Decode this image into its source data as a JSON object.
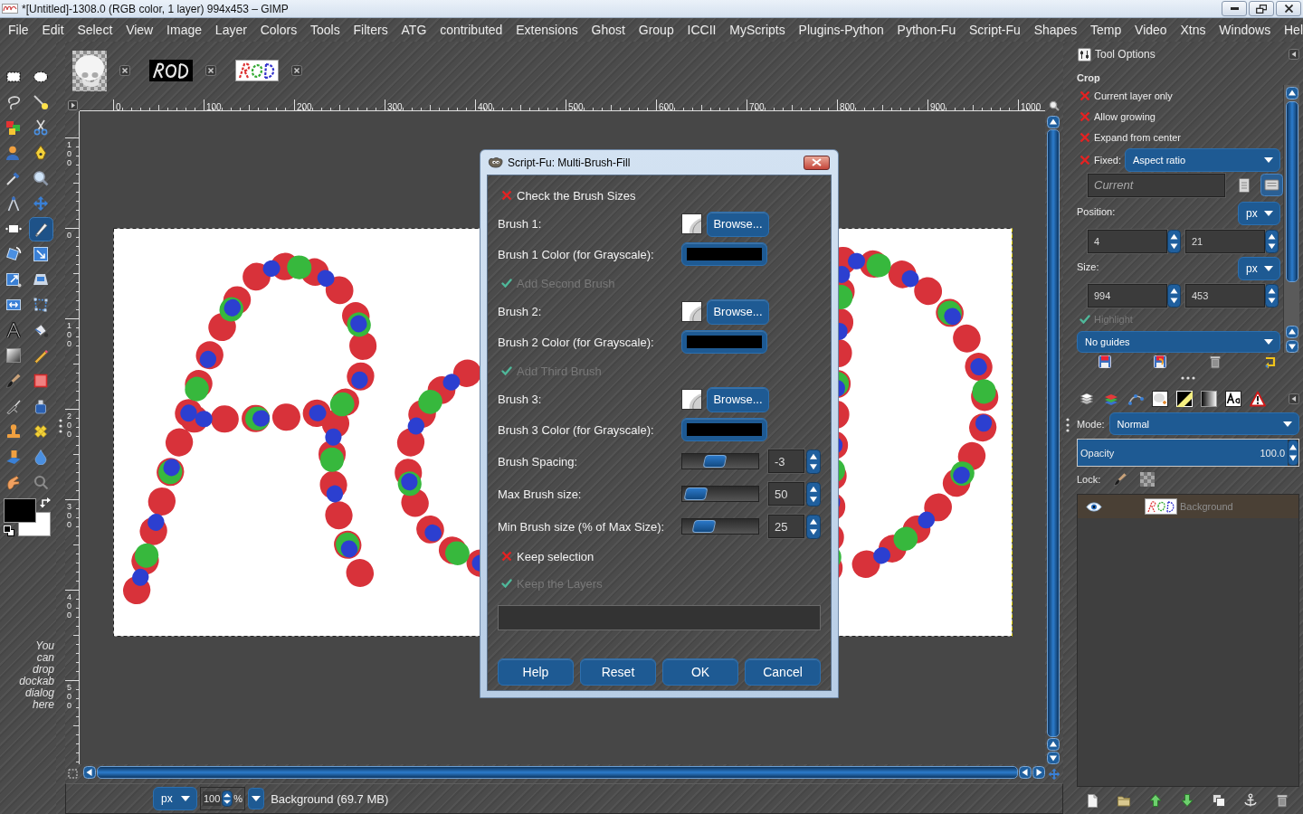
{
  "window": {
    "title": "*[Untitled]-1308.0 (RGB color, 1 layer) 994x453 – GIMP",
    "controls": [
      {
        "kind": "minimize"
      },
      {
        "kind": "maximize"
      },
      {
        "kind": "close"
      }
    ]
  },
  "menu": [
    {
      "label": "File"
    },
    {
      "label": "Edit"
    },
    {
      "label": "Select"
    },
    {
      "label": "View"
    },
    {
      "label": "Image"
    },
    {
      "label": "Layer"
    },
    {
      "label": "Colors"
    },
    {
      "label": "Tools"
    },
    {
      "label": "Filters"
    },
    {
      "label": "ATG"
    },
    {
      "label": "contributed"
    },
    {
      "label": "Extensions"
    },
    {
      "label": "Ghost"
    },
    {
      "label": "Group"
    },
    {
      "label": "ICCII"
    },
    {
      "label": "MyScripts"
    },
    {
      "label": "Plugins-Python"
    },
    {
      "label": "Python-Fu"
    },
    {
      "label": "Script-Fu"
    },
    {
      "label": "Shapes"
    },
    {
      "label": "Temp"
    },
    {
      "label": "Video"
    },
    {
      "label": "Xtns"
    },
    {
      "label": "Windows"
    },
    {
      "label": "Hel"
    }
  ],
  "toolbox": {
    "tools": [
      {
        "kind": "rect-select",
        "selected": false
      },
      {
        "kind": "ellipse-select",
        "selected": false
      },
      {
        "kind": "free-select",
        "selected": false
      },
      {
        "kind": "fuzzy-select",
        "selected": false
      },
      {
        "kind": "select-by-color",
        "selected": false
      },
      {
        "kind": "scissors",
        "selected": false
      },
      {
        "kind": "foreground-select",
        "selected": false
      },
      {
        "kind": "paths",
        "selected": false
      },
      {
        "kind": "color-picker",
        "selected": false
      },
      {
        "kind": "zoom",
        "selected": false
      },
      {
        "kind": "measure",
        "selected": false
      },
      {
        "kind": "move",
        "selected": false
      },
      {
        "kind": "align",
        "selected": false
      },
      {
        "kind": "crop",
        "selected": true
      },
      {
        "kind": "rotate",
        "selected": false
      },
      {
        "kind": "scale",
        "selected": false
      },
      {
        "kind": "shear",
        "selected": false
      },
      {
        "kind": "perspective",
        "selected": false
      },
      {
        "kind": "flip",
        "selected": false
      },
      {
        "kind": "cage",
        "selected": false
      },
      {
        "kind": "text",
        "selected": false
      },
      {
        "kind": "bucket-fill",
        "selected": false
      },
      {
        "kind": "blend",
        "selected": false
      },
      {
        "kind": "pencil",
        "selected": false
      },
      {
        "kind": "paintbrush",
        "selected": false
      },
      {
        "kind": "eraser",
        "selected": false
      },
      {
        "kind": "airbrush",
        "selected": false
      },
      {
        "kind": "ink",
        "selected": false
      },
      {
        "kind": "clone",
        "selected": false
      },
      {
        "kind": "heal",
        "selected": false
      },
      {
        "kind": "perspective-clone",
        "selected": false
      },
      {
        "kind": "blur",
        "selected": false
      },
      {
        "kind": "smudge",
        "selected": false
      },
      {
        "kind": "dodge-burn",
        "selected": false
      }
    ],
    "colors": [
      {
        "kind": "foreground",
        "color": "#000000"
      },
      {
        "kind": "background",
        "color": "#ffffff"
      }
    ],
    "hint": "You can drop dockab dialog here"
  },
  "image_tabs": [
    {
      "kind": "skull"
    },
    {
      "kind": "lettering-dark"
    },
    {
      "kind": "lettering-light"
    }
  ],
  "rulers": {
    "horizontal": [
      "0",
      "100",
      "200",
      "300",
      "400",
      "500",
      "600",
      "700",
      "800",
      "900",
      "1000"
    ],
    "vertical": [
      "100",
      "0",
      "100",
      "200",
      "300",
      "400",
      "500"
    ]
  },
  "status_bar": {
    "unit": "px",
    "zoom": "100",
    "zoom_unit": "%",
    "message": "Background (69.7 MB)"
  },
  "dialog": {
    "title": "Script-Fu: Multi-Brush-Fill",
    "rows": [
      {
        "kind": "check",
        "label": "Check the Brush Sizes",
        "checked": false,
        "disabled": false
      },
      {
        "kind": "brush",
        "label": "Brush 1:",
        "button": "Browse..."
      },
      {
        "kind": "color",
        "label": "Brush 1 Color (for Grayscale):",
        "color": "#000000"
      },
      {
        "kind": "check",
        "label": "Add Second Brush",
        "checked": true,
        "disabled": true
      },
      {
        "kind": "brush",
        "label": "Brush 2:",
        "button": "Browse..."
      },
      {
        "kind": "color",
        "label": "Brush 2 Color (for Grayscale):",
        "color": "#000000"
      },
      {
        "kind": "check",
        "label": "Add Third Brush",
        "checked": true,
        "disabled": true
      },
      {
        "kind": "brush",
        "label": "Brush 3:",
        "button": "Browse..."
      },
      {
        "kind": "color",
        "label": "Brush 3 Color (for Grayscale):",
        "color": "#000000"
      },
      {
        "kind": "slider",
        "label": "Brush Spacing:",
        "value": "-3",
        "level": 0.4
      },
      {
        "kind": "slider",
        "label": "Max Brush size:",
        "value": "50",
        "level": 0.05
      },
      {
        "kind": "slider",
        "label": "Min Brush size (% of Max Size):",
        "value": "25",
        "level": 0.2
      },
      {
        "kind": "check",
        "label": "Keep selection",
        "checked": false,
        "disabled": false
      },
      {
        "kind": "check",
        "label": "Keep the Layers",
        "checked": true,
        "disabled": true
      },
      {
        "kind": "progress",
        "level": 0
      }
    ],
    "buttons": [
      {
        "label": "Help"
      },
      {
        "label": "Reset"
      },
      {
        "label": "OK"
      },
      {
        "label": "Cancel"
      }
    ]
  },
  "tool_options": {
    "title": "Tool Options",
    "tool": "Crop",
    "options": [
      {
        "kind": "check",
        "label": "Current layer only",
        "checked": false,
        "disabled": false
      },
      {
        "kind": "check",
        "label": "Allow growing",
        "checked": false,
        "disabled": false
      },
      {
        "kind": "check",
        "label": "Expand from center",
        "checked": false,
        "disabled": false
      },
      {
        "kind": "fixed",
        "label": "Fixed:",
        "checked": false,
        "value": "Aspect ratio"
      },
      {
        "kind": "ratio",
        "placeholder": "Current",
        "orientations": [
          {
            "kind": "portrait",
            "selected": false
          },
          {
            "kind": "landscape",
            "selected": true
          }
        ]
      },
      {
        "kind": "unit",
        "label": "Position:",
        "unit": "px"
      },
      {
        "kind": "pair",
        "values": [
          "4",
          "21"
        ]
      },
      {
        "kind": "unit",
        "label": "Size:",
        "unit": "px"
      },
      {
        "kind": "pair",
        "values": [
          "994",
          "453"
        ]
      },
      {
        "kind": "check",
        "label": "Highlight",
        "checked": true,
        "disabled": true
      },
      {
        "kind": "dropdown",
        "value": "No guides"
      }
    ],
    "buttons": [
      {
        "kind": "save"
      },
      {
        "kind": "restore"
      },
      {
        "kind": "delete"
      },
      {
        "kind": "reset"
      }
    ]
  },
  "layers_panel": {
    "tabs": [
      {
        "kind": "layers"
      },
      {
        "kind": "channels"
      },
      {
        "kind": "paths"
      },
      {
        "kind": "brushes"
      },
      {
        "kind": "patterns"
      },
      {
        "kind": "gradients"
      },
      {
        "kind": "fonts"
      },
      {
        "kind": "errors"
      }
    ],
    "mode": {
      "label": "Mode:",
      "value": "Normal"
    },
    "opacity": {
      "label": "Opacity",
      "value": "100.0",
      "level": 1
    },
    "lock": {
      "label": "Lock:",
      "items": [
        {
          "kind": "pixels"
        },
        {
          "kind": "alpha"
        }
      ]
    },
    "layers": [
      {
        "name": "Background",
        "visible": true,
        "selected": true
      }
    ],
    "buttons": [
      {
        "kind": "new"
      },
      {
        "kind": "group"
      },
      {
        "kind": "raise"
      },
      {
        "kind": "lower"
      },
      {
        "kind": "duplicate"
      },
      {
        "kind": "anchor"
      },
      {
        "kind": "delete"
      }
    ]
  }
}
